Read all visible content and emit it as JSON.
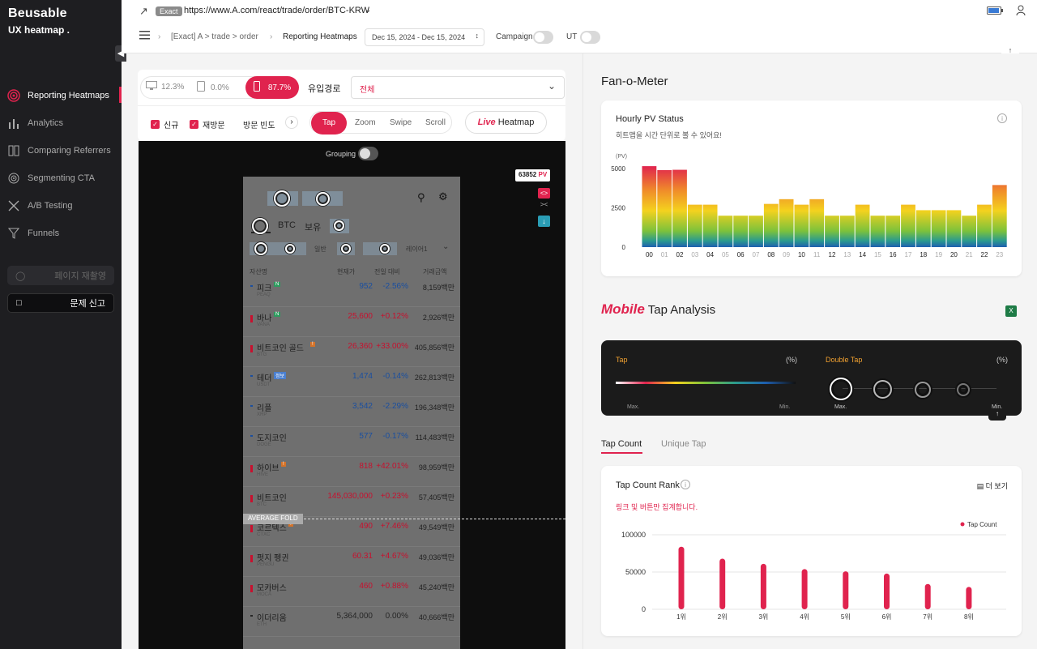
{
  "brand": {
    "logo": "Beusable",
    "sub": "UX heatmap ."
  },
  "nav": [
    {
      "label": "Reporting Heatmaps",
      "icon": "target-icon"
    },
    {
      "label": "Analytics",
      "icon": "bar-chart-icon"
    },
    {
      "label": "Comparing Referrers",
      "icon": "columns-icon"
    },
    {
      "label": "Segmenting CTA",
      "icon": "radar-icon"
    },
    {
      "label": "A/B Testing",
      "icon": "split-icon"
    },
    {
      "label": "Funnels",
      "icon": "funnel-icon"
    }
  ],
  "side_buttons": {
    "reshoot": "페이지 재촬영",
    "report": "문제 신고"
  },
  "topbar": {
    "match": "Exact",
    "url": "https://www.A.com/react/trade/order/BTC-KRW",
    "breadcrumb": "[Exact] A > trade > order",
    "page": "Reporting Heatmaps",
    "daterange": "Dec 15, 2024 - Dec 15, 2024",
    "campaign": "Campaign",
    "ut": "UT"
  },
  "controls": {
    "devices": [
      {
        "pct": "12.3%",
        "icon": "desktop-icon"
      },
      {
        "pct": "0.0%",
        "icon": "tablet-icon"
      },
      {
        "pct": "87.7%",
        "icon": "mobile-icon"
      }
    ],
    "source_label": "유입경로",
    "source_value": "전체",
    "filters": [
      "신규",
      "재방문"
    ],
    "visit_freq": "방문 빈도",
    "modes": [
      "Tap",
      "Zoom",
      "Swipe",
      "Scroll"
    ],
    "live_word": "Live",
    "live_rest": "Heatmap",
    "grouping": "Grouping",
    "pv": "63852",
    "pv_unit": "PV",
    "fold": "AVERAGE FOLD"
  },
  "phone": {
    "tabs": [
      "BTC",
      "보유"
    ],
    "subtabs": [
      "일반",
      "레이어1"
    ],
    "headers": [
      "자산명",
      "현재가",
      "전일 대비",
      "거래금액"
    ],
    "rows": [
      {
        "name": "피크",
        "code": "PEAQ",
        "price": "952",
        "change": "-2.56%",
        "volume": "8,159백만",
        "dir": "down",
        "badge": "N"
      },
      {
        "name": "바나",
        "code": "VANA",
        "price": "25,600",
        "change": "+0.12%",
        "volume": "2,926백만",
        "dir": "up",
        "badge": "N"
      },
      {
        "name": "비트코인 골드",
        "code": "BTG",
        "price": "26,360",
        "change": "+33.00%",
        "volume": "405,856백만",
        "dir": "up",
        "badge": "!"
      },
      {
        "name": "테더",
        "code": "USDT",
        "price": "1,474",
        "change": "-0.14%",
        "volume": "262,813백만",
        "dir": "down",
        "badge": "정보"
      },
      {
        "name": "리플",
        "code": "XRP",
        "price": "3,542",
        "change": "-2.29%",
        "volume": "196,348백만",
        "dir": "down",
        "badge": ""
      },
      {
        "name": "도지코인",
        "code": "DOGE",
        "price": "577",
        "change": "-0.17%",
        "volume": "114,483백만",
        "dir": "down",
        "badge": ""
      },
      {
        "name": "하이브",
        "code": "HIVE",
        "price": "818",
        "change": "+42.01%",
        "volume": "98,959백만",
        "dir": "up",
        "badge": "!"
      },
      {
        "name": "비트코인",
        "code": "BTC",
        "price": "145,030,000",
        "change": "+0.23%",
        "volume": "57,405백만",
        "dir": "up",
        "badge": ""
      },
      {
        "name": "코르텍스",
        "code": "CTXC",
        "price": "490",
        "change": "+7.46%",
        "volume": "49,549백만",
        "dir": "up",
        "badge": "!"
      },
      {
        "name": "펏지 펭귄",
        "code": "PENGU",
        "price": "60.31",
        "change": "+4.67%",
        "volume": "49,036백만",
        "dir": "up",
        "badge": ""
      },
      {
        "name": "모카버스",
        "code": "MOCA",
        "price": "460",
        "change": "+0.88%",
        "volume": "45,240백만",
        "dir": "up",
        "badge": ""
      },
      {
        "name": "이더리움",
        "code": "ETH",
        "price": "5,364,000",
        "change": "0.00%",
        "volume": "40,666백만",
        "dir": "flat",
        "badge": ""
      }
    ]
  },
  "fan": {
    "title": "Fan-o-Meter",
    "card_title": "Hourly PV Status",
    "card_sub": "히트맵을 시간 단위로 볼 수 있어요!",
    "y_unit": "(PV)"
  },
  "chart_data": [
    {
      "type": "bar",
      "title": "Hourly PV Status",
      "ylabel": "(PV)",
      "ylim": [
        0,
        5000
      ],
      "yticks": [
        0,
        2500,
        5000
      ],
      "categories": [
        "00",
        "01",
        "02",
        "03",
        "04",
        "05",
        "06",
        "07",
        "08",
        "09",
        "10",
        "11",
        "12",
        "13",
        "14",
        "15",
        "16",
        "17",
        "18",
        "19",
        "20",
        "21",
        "22",
        "23"
      ],
      "values": [
        5150,
        4900,
        4920,
        2700,
        2700,
        2000,
        2000,
        2000,
        2750,
        3050,
        2700,
        3050,
        2000,
        2000,
        2700,
        2000,
        2000,
        2700,
        2350,
        2350,
        2350,
        2000,
        2700,
        3950
      ],
      "bold_labels": [
        "00",
        "02",
        "04",
        "06",
        "08",
        "10",
        "12",
        "14",
        "16",
        "18",
        "20",
        "22"
      ]
    },
    {
      "type": "bar",
      "title": "Tap Count Rank",
      "ylim": [
        0,
        100000
      ],
      "yticks": [
        0,
        50000,
        100000
      ],
      "legend": "Tap Count",
      "legend_position": "top-right",
      "categories": [
        "1위",
        "2위",
        "3위",
        "4위",
        "5위",
        "6위",
        "7위",
        "8위"
      ],
      "values": [
        84000,
        68000,
        61000,
        54000,
        51000,
        48000,
        34000,
        30000
      ]
    }
  ],
  "tap": {
    "title_word": "Mobile",
    "title_rest": "Tap Analysis",
    "legend_tap": "Tap",
    "legend_dtap": "Double Tap",
    "pct": "(%)",
    "max": "Max.",
    "min": "Min.",
    "tabs": [
      "Tap Count",
      "Unique Tap"
    ],
    "rank_title": "Tap Count Rank",
    "more": "더 보기",
    "note": "링크 및 버튼만 집계합니다."
  },
  "colors": {
    "accent": "#e0234e",
    "sidebar": "#1e1e21"
  }
}
